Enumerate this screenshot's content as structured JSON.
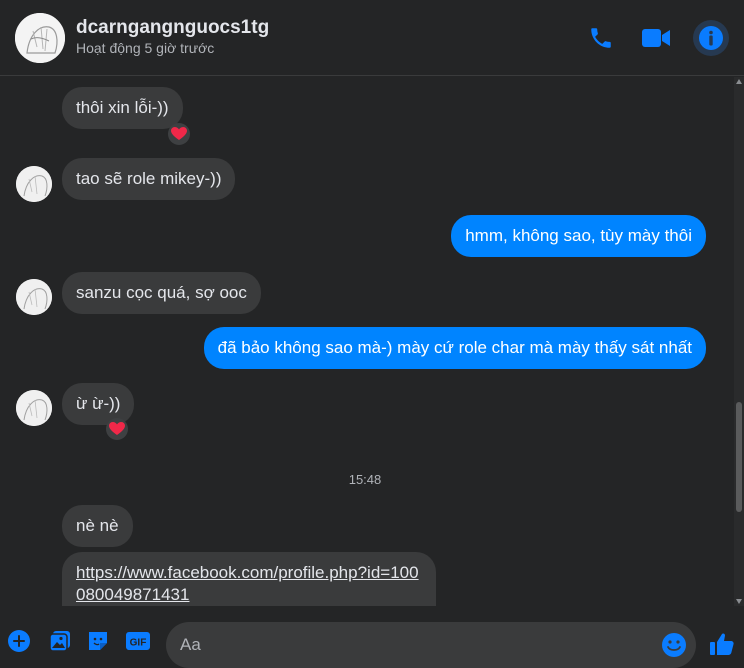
{
  "header": {
    "contact_name": "dcarngangnguocs1tg",
    "status": "Hoạt động 5 giờ trước",
    "icons": [
      "phone-icon",
      "video-camera-icon",
      "info-icon"
    ]
  },
  "messages": [
    {
      "from": "them",
      "text": "thôi xin lỗi-))",
      "reaction": "❤️"
    },
    {
      "from": "them",
      "text": "tao sẽ role mikey-))"
    },
    {
      "from": "me",
      "text": "hmm, không sao, tùy mày thôi"
    },
    {
      "from": "them",
      "text": "sanzu cọc quá, sợ ooc"
    },
    {
      "from": "me",
      "text": "đã bảo không sao mà-) mày cứ role char mà mày thấy sát nhất"
    },
    {
      "from": "them",
      "text": "ừ ừ-))",
      "reaction": "❤️"
    },
    {
      "type": "timestamp",
      "text": "15:48"
    },
    {
      "from": "them",
      "text": "nè nè"
    },
    {
      "from": "them",
      "type": "link",
      "text": "https://www.facebook.com/profile.php?id=100080049871431"
    }
  ],
  "composer": {
    "placeholder": "Aa",
    "icons": [
      "plus-icon",
      "photo-icon",
      "sticker-icon",
      "gif-icon",
      "emoji-icon",
      "like-icon"
    ],
    "gif_label": "GIF"
  },
  "colors": {
    "accent": "#0084ff",
    "background": "#242526",
    "incoming_bubble": "#3a3b3c",
    "reaction_heart": "#f02849"
  }
}
